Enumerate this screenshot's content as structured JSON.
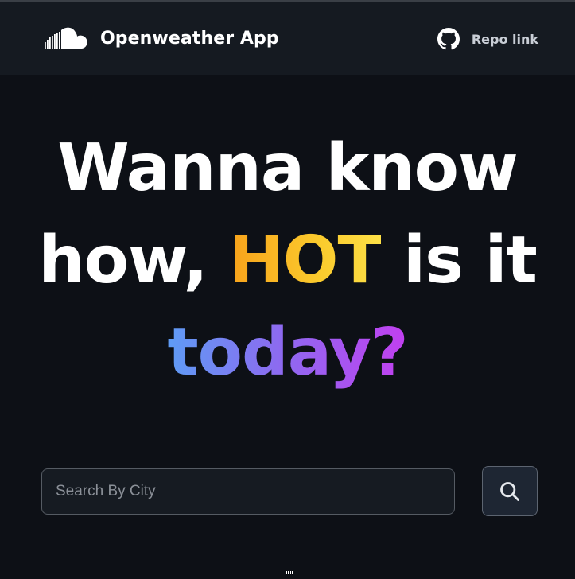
{
  "header": {
    "brand_icon": "soundcloud-cloud-icon",
    "title": "Openweather App",
    "repo_icon": "github-icon",
    "repo_label": "Repo link"
  },
  "hero": {
    "line1": "Wanna know",
    "line2_prefix": "how,",
    "line2_highlight": "HOT",
    "line2_suffix": "is it",
    "line3_highlight": "today?",
    "colors": {
      "hot_gradient": [
        "#f7a21b",
        "#fde047"
      ],
      "today_gradient": [
        "#5e9cf5",
        "#c23ff0"
      ]
    }
  },
  "search": {
    "placeholder": "Search By City",
    "value": "",
    "button_icon": "search-icon"
  },
  "colors": {
    "background": "#0d1016",
    "navbar": "#151a21",
    "input_background": "#161b22"
  }
}
